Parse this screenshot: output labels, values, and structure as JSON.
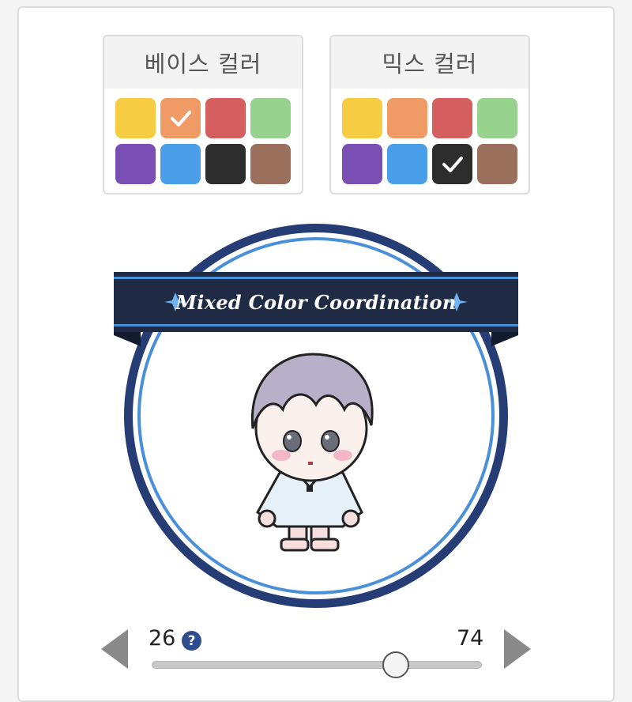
{
  "base_palette": {
    "title": "베이스 컬러",
    "selected_index": 1,
    "swatches": [
      {
        "name": "yellow",
        "color": "#f6cc43"
      },
      {
        "name": "orange",
        "color": "#f09a65"
      },
      {
        "name": "red",
        "color": "#d55e5e"
      },
      {
        "name": "green",
        "color": "#98d28f"
      },
      {
        "name": "purple",
        "color": "#7a4fb4"
      },
      {
        "name": "blue",
        "color": "#4a9fe8"
      },
      {
        "name": "black",
        "color": "#2d2d2d"
      },
      {
        "name": "brown",
        "color": "#9b715d"
      }
    ]
  },
  "mix_palette": {
    "title": "믹스 컬러",
    "selected_index": 6,
    "swatches": [
      {
        "name": "yellow",
        "color": "#f6cc43"
      },
      {
        "name": "orange",
        "color": "#f09a65"
      },
      {
        "name": "red",
        "color": "#d55e5e"
      },
      {
        "name": "green",
        "color": "#98d28f"
      },
      {
        "name": "purple",
        "color": "#7a4fb4"
      },
      {
        "name": "blue",
        "color": "#4a9fe8"
      },
      {
        "name": "black",
        "color": "#2d2d2d"
      },
      {
        "name": "brown",
        "color": "#9b715d"
      }
    ]
  },
  "preview": {
    "banner_text": "Mixed Color Coordination",
    "ring_color": "#263c74",
    "inner_ring_color": "#4a90d9",
    "banner_color": "#1f2a45"
  },
  "slider": {
    "left_value": "26",
    "right_value": "74",
    "help_label": "?",
    "position_percent": 74
  },
  "icons": {
    "check": "check-icon",
    "left": "left-arrow-icon",
    "right": "right-arrow-icon",
    "help": "help-icon"
  }
}
